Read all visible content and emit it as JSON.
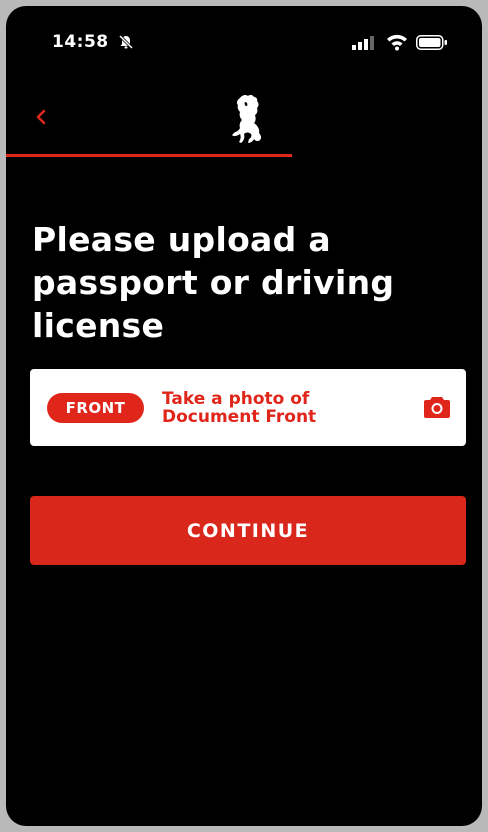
{
  "status_bar": {
    "time": "14:58",
    "icons": [
      "bell-slash-icon",
      "signal-icon",
      "wifi-icon",
      "battery-icon"
    ]
  },
  "nav": {
    "back_icon": "chevron-left-icon",
    "logo_icon": "prancing-horse-logo-icon",
    "progress": 0.6
  },
  "page": {
    "title": "Please upload a passport or driving license"
  },
  "upload_card": {
    "badge": "FRONT",
    "label_line1": "Take a photo of",
    "label_line2": "Document Front",
    "icon": "camera-icon"
  },
  "actions": {
    "continue_label": "CONTINUE"
  },
  "colors": {
    "background": "#000000",
    "accent": "#e0261b",
    "card": "#ffffff",
    "text": "#ffffff"
  }
}
